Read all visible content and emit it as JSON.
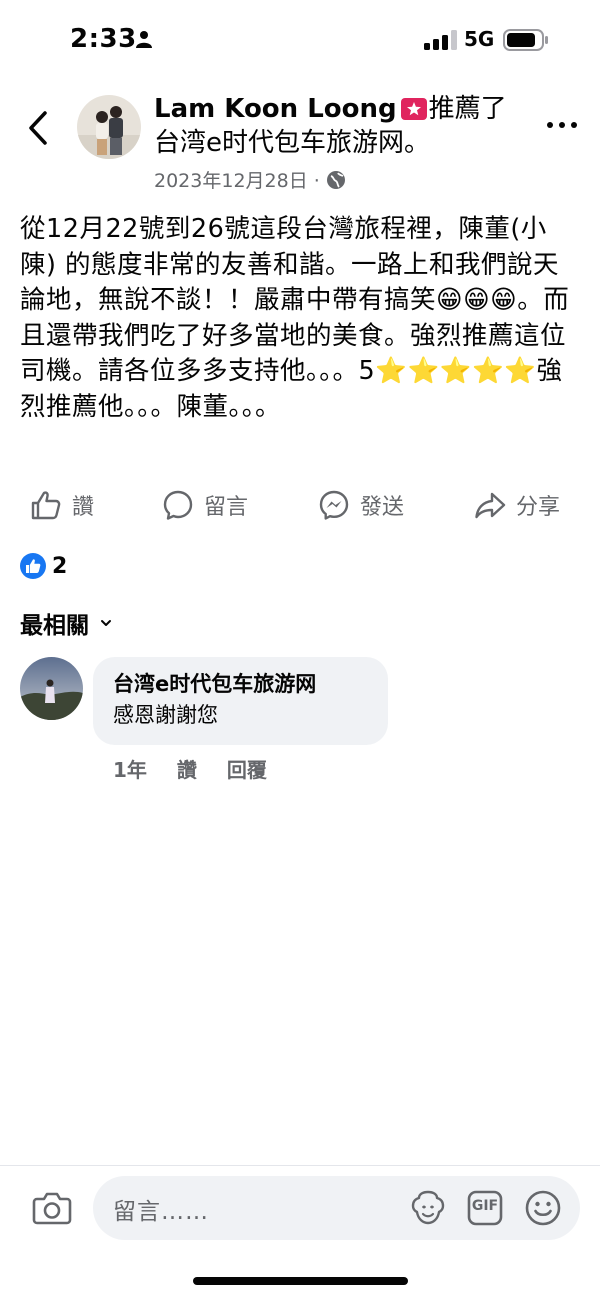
{
  "status_bar": {
    "time": "2:33",
    "network": "5G"
  },
  "post": {
    "author": "Lam Koon Loong",
    "action_text": "推薦了台湾e时代包车旅游网。",
    "date": "2023年12月28日 ·",
    "privacy_icon": "globe-icon",
    "body": "從12月22號到26號這段台灣旅程裡，陳董(小陳) 的態度非常的友善和諧。一路上和我們說天論地，無說不談！！嚴肅中帶有搞笑😁😁😁。而且還帶我們吃了好多當地的美食。強烈推薦這位司機。請各位多多支持他。。。5⭐⭐⭐⭐⭐強烈推薦他。。。陳董。。。"
  },
  "actions": {
    "like": "讚",
    "comment": "留言",
    "send": "發送",
    "share": "分享"
  },
  "reactions": {
    "count": "2",
    "icon": "like-reaction-icon"
  },
  "comments": {
    "sort_label": "最相關",
    "items": [
      {
        "author": "台湾e时代包车旅游网",
        "text": "感恩謝謝您",
        "time": "1年",
        "like": "讚",
        "reply": "回覆"
      }
    ]
  },
  "composer": {
    "placeholder": "留言……",
    "gif_label": "GIF"
  },
  "colors": {
    "facebook_blue": "#1877f2",
    "recommend_red": "#e0245e",
    "secondary_text": "#65676b",
    "bubble_bg": "#f0f2f5"
  }
}
